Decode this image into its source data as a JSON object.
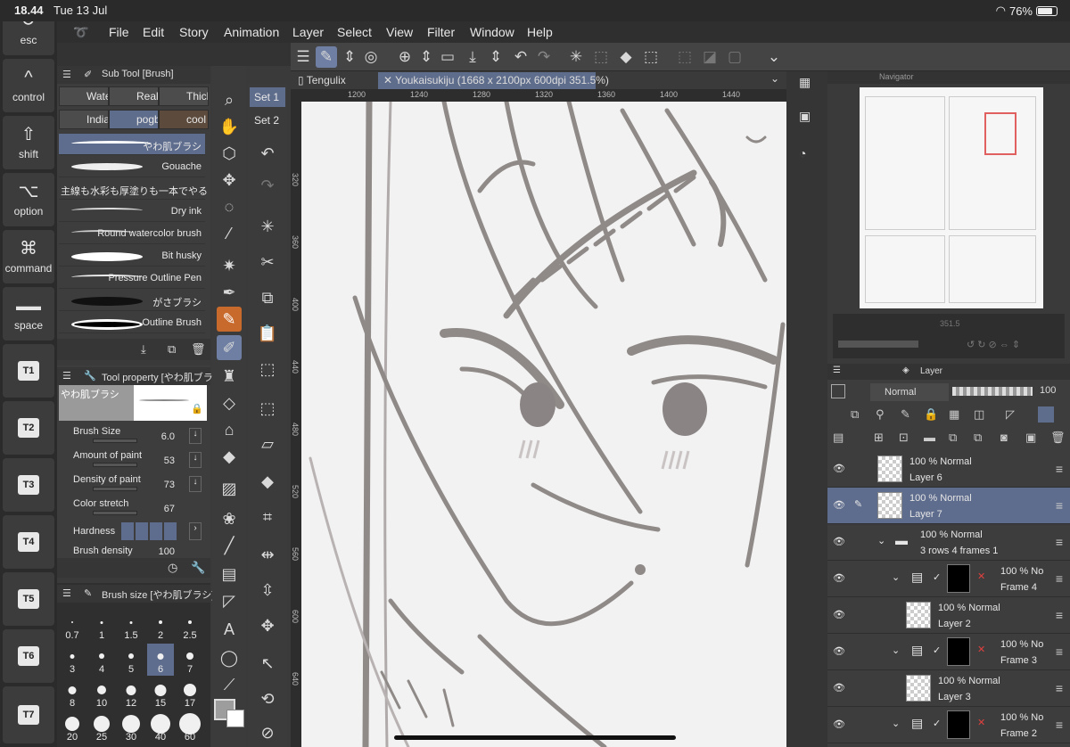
{
  "status": {
    "time": "18.44",
    "date": "Tue 13 Jul",
    "battery": "76%"
  },
  "keys": [
    {
      "glyph": "⎋",
      "label": "esc"
    },
    {
      "glyph": "^",
      "label": "control"
    },
    {
      "glyph": "⇧",
      "label": "shift"
    },
    {
      "glyph": "⌥",
      "label": "option"
    },
    {
      "glyph": "⌘",
      "label": "command"
    },
    {
      "glyph": "▬",
      "label": "space"
    }
  ],
  "tkeys": [
    "T1",
    "T2",
    "T3",
    "T4",
    "T5",
    "T6",
    "T7"
  ],
  "menu": [
    "File",
    "Edit",
    "Story",
    "Animation",
    "Layer",
    "Select",
    "View",
    "Filter",
    "Window",
    "Help"
  ],
  "subtool": {
    "title": "Sub Tool [Brush]",
    "tabs": [
      "Water",
      "Realis",
      "Thick",
      "India",
      "pogbi",
      "cool w"
    ],
    "brushes": [
      "やわ肌ブラシ",
      "Gouache",
      "主線も水彩も厚塗りも一本でやる",
      "Dry ink",
      "Round watercolor brush",
      "Bit husky",
      "Pressure Outline Pen",
      "がさブラシ",
      "Outline Brush"
    ]
  },
  "toolprop": {
    "title": "Tool property [やわ肌ブラシ",
    "preview_label": "やわ肌ブラシ",
    "props": [
      {
        "label": "Brush Size",
        "value": "6.0"
      },
      {
        "label": "Amount of paint",
        "value": "53"
      },
      {
        "label": "Density of paint",
        "value": "73"
      },
      {
        "label": "Color stretch",
        "value": "67"
      }
    ],
    "hardness_label": "Hardness",
    "density_label": "Brush density",
    "density_value": "100"
  },
  "brushsize": {
    "title": "Brush size [やわ肌ブラシ]",
    "sizes": [
      "0.7",
      "1",
      "1.5",
      "2",
      "2.5",
      "3",
      "4",
      "5",
      "6",
      "7",
      "8",
      "10",
      "12",
      "15",
      "17",
      "20",
      "25",
      "30",
      "40",
      "60"
    ]
  },
  "sets": [
    "Set 1",
    "Set 2"
  ],
  "canvas": {
    "tabs": [
      "Tengulix",
      "Youkaisukiju (1668 x 2100px 600dpi 351.5%)"
    ],
    "ruler_top": [
      "1200",
      "1240",
      "1280",
      "1320",
      "1360",
      "1400",
      "1440"
    ],
    "ruler_left": [
      "320",
      "360",
      "400",
      "440",
      "480",
      "520",
      "560",
      "600",
      "640"
    ]
  },
  "navigator": {
    "title": "Navigator",
    "zoom": "351.5"
  },
  "layers": {
    "title": "Layer",
    "blend_mode": "Normal",
    "opacity": "100",
    "rows": [
      {
        "pct": "100 %",
        "mode": "Normal",
        "name": "Layer 6"
      },
      {
        "pct": "100 %",
        "mode": "Normal",
        "name": "Layer 7"
      },
      {
        "pct": "100 %",
        "mode": "Normal",
        "name": "3 rows 4 frames 1"
      },
      {
        "pct": "100 %",
        "mode": "No",
        "name": "Frame 4"
      },
      {
        "pct": "100 %",
        "mode": "Normal",
        "name": "Layer 2"
      },
      {
        "pct": "100 %",
        "mode": "No",
        "name": "Frame 3"
      },
      {
        "pct": "100 %",
        "mode": "Normal",
        "name": "Layer 3"
      },
      {
        "pct": "100 %",
        "mode": "No",
        "name": "Frame 2"
      }
    ]
  },
  "colors": {
    "accent": "#5f6d8c",
    "orange": "#c86a2c",
    "panel": "#3d3d3d"
  }
}
